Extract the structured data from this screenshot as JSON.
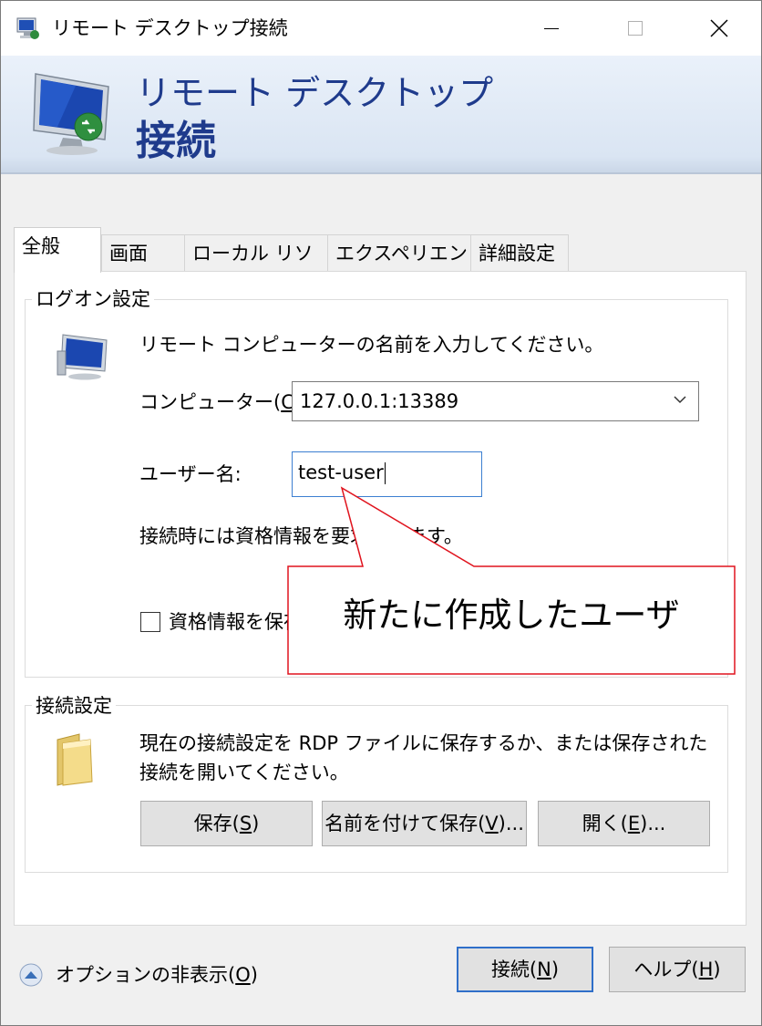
{
  "window": {
    "title": "リモート デスクトップ接続"
  },
  "banner": {
    "line1": "リモート デスクトップ",
    "line2": "接続"
  },
  "tabs": [
    {
      "label": "全般",
      "active": true
    },
    {
      "label": "画面",
      "active": false
    },
    {
      "label": "ローカル リソース",
      "active": false
    },
    {
      "label": "エクスペリエンス",
      "active": false
    },
    {
      "label": "詳細設定",
      "active": false
    }
  ],
  "logon": {
    "group_label": "ログオン設定",
    "instruction": "リモート コンピューターの名前を入力してください。",
    "computer_label": "コンピューター(",
    "computer_key": "C",
    "computer_label_end": "):",
    "computer_value": "127.0.0.1:13389",
    "username_label": "ユーザー名:",
    "username_value": "test-user",
    "credential_note": "接続時には資格情報を要求されます。",
    "save_credentials_label": "資格情報を保存できるようにする",
    "save_credentials_checked": false
  },
  "connection": {
    "group_label": "接続設定",
    "description_line1": "現在の接続設定を RDP ファイルに保存するか、または保存された",
    "description_line2": "接続を開いてください。",
    "save_button": {
      "label": "保存(",
      "key": "S",
      "end": ")"
    },
    "save_as_button": {
      "label": "名前を付けて保存(",
      "key": "V",
      "end": ")..."
    },
    "open_button": {
      "label": "開く(",
      "key": "E",
      "end": ")..."
    }
  },
  "footer": {
    "options_label": "オプションの非表示(",
    "options_key": "O",
    "options_end": ")",
    "connect_button": {
      "label": "接続(",
      "key": "N",
      "end": ")"
    },
    "help_button": {
      "label": "ヘルプ(",
      "key": "H",
      "end": ")"
    }
  },
  "annotation": {
    "text": "新たに作成したユーザ",
    "color": "#e0141e"
  }
}
